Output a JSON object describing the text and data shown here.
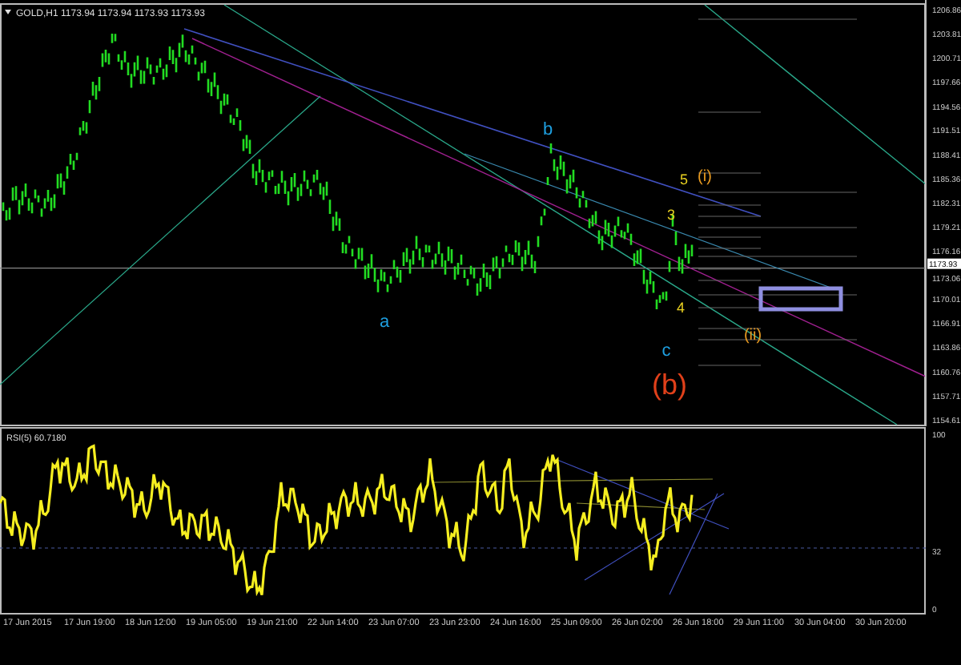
{
  "chart_header": {
    "title": "GOLD,H1  1173.94 1173.94 1173.93 1173.93"
  },
  "price_axis": {
    "labels": [
      "1206.86",
      "1203.81",
      "1200.71",
      "1197.66",
      "1194.56",
      "1191.51",
      "1188.41",
      "1185.36",
      "1182.31",
      "1179.21",
      "1176.16",
      "1173.06",
      "1170.01",
      "1166.91",
      "1163.86",
      "1160.76",
      "1157.71",
      "1154.61"
    ],
    "current_price": "1173.93"
  },
  "wave_labels": [
    {
      "text": "b",
      "color": "#1e9fe0"
    },
    {
      "text": "(i)",
      "color": "#e89a20"
    },
    {
      "text": "5",
      "color": "#e8d020"
    },
    {
      "text": "3",
      "color": "#e8d020"
    },
    {
      "text": "4",
      "color": "#e8d020"
    },
    {
      "text": "a",
      "color": "#1e9fe0"
    },
    {
      "text": "(ii)",
      "color": "#e89a20"
    },
    {
      "text": "c",
      "color": "#1e9fe0"
    },
    {
      "text": "(b)",
      "color": "#e0401a"
    }
  ],
  "rsi": {
    "title": "RSI(5) 60.7180",
    "axis_labels": [
      "100",
      "32",
      "0"
    ]
  },
  "time_axis": {
    "labels": [
      "17 Jun 2015",
      "17 Jun 19:00",
      "18 Jun 12:00",
      "19 Jun 05:00",
      "19 Jun 21:00",
      "22 Jun 14:00",
      "23 Jun 07:00",
      "23 Jun 23:00",
      "24 Jun 16:00",
      "25 Jun 09:00",
      "26 Jun 02:00",
      "26 Jun 18:00",
      "29 Jun 11:00",
      "30 Jun 04:00",
      "30 Jun 20:00"
    ]
  }
}
